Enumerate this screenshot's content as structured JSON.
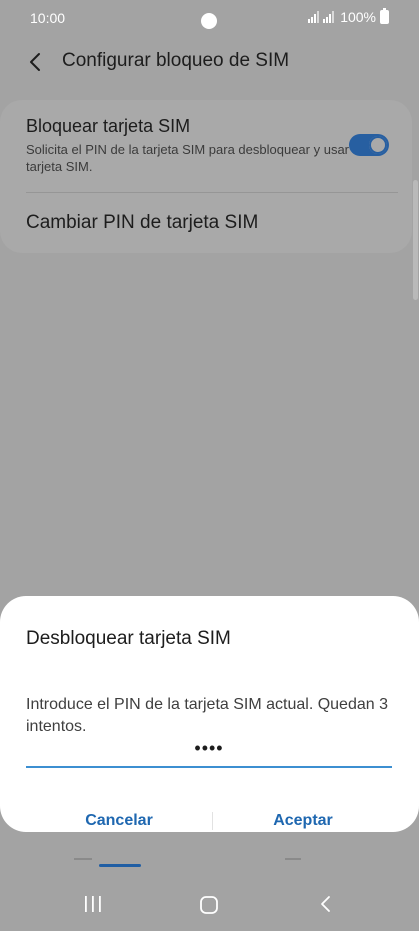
{
  "status_bar": {
    "time": "10:00",
    "battery": "100%"
  },
  "header": {
    "title": "Configurar bloqueo de SIM",
    "back_icon": "chevron-left-icon"
  },
  "settings": {
    "lock_sim": {
      "title": "Bloquear tarjeta SIM",
      "subtitle": "Solicita el PIN de la tarjeta SIM para desbloquear y usar la tarjeta SIM.",
      "enabled": true
    },
    "change_pin": {
      "title": "Cambiar PIN de tarjeta SIM"
    }
  },
  "dialog": {
    "title": "Desbloquear tarjeta SIM",
    "message": "Introduce el PIN de la tarjeta SIM actual. Quedan 3 intentos.",
    "pin_value": "••••",
    "cancel_label": "Cancelar",
    "accept_label": "Aceptar"
  },
  "nav_bar": {
    "recent_icon": "recent-apps-icon",
    "home_icon": "home-icon",
    "back_icon": "back-icon"
  },
  "colors": {
    "accent": "#1e67b0",
    "toggle_on": "#275fa1",
    "dim_background": "#a3a3a3",
    "dialog_background": "#ffffff"
  }
}
